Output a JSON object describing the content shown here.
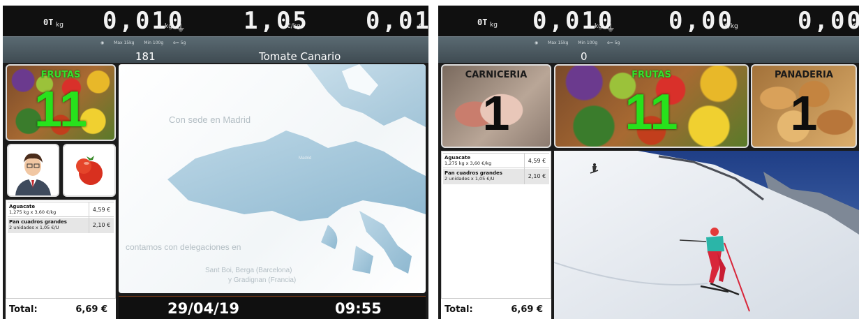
{
  "left": {
    "lcd": {
      "tare": "0T",
      "tare_unit": "kg",
      "weight": "0,010",
      "weight_unit": "kg",
      "price": "1,05",
      "price_unit": "€/kg",
      "total": "0,01",
      "total_unit": "€"
    },
    "info": {
      "max": "Max 15kg",
      "min": "Min 100g",
      "e": "e= 5g",
      "code": "181",
      "product": "Tomate Canario"
    },
    "category": {
      "name": "FRUTAS",
      "count": "11"
    },
    "ticket": {
      "lines": [
        {
          "name": "Aguacate",
          "detail": "1,275 kg x 3,60 €/kg",
          "amount": "4,59 €"
        },
        {
          "name": "Pan cuadros grandes",
          "detail": "2 unidades x 1,05 €/U",
          "amount": "2,10 €"
        }
      ],
      "total_label": "Total:",
      "total_value": "6,69 €"
    },
    "map": {
      "heading": "Con sede en Madrid",
      "small": "Madrid",
      "line1": "contamos con delegaciones en",
      "line2": "Sant Boi, Berga (Barcelona)",
      "line3": "y Gradignan (Francia)"
    },
    "date": "29/04/19",
    "time": "09:55"
  },
  "right": {
    "lcd": {
      "tare": "0T",
      "tare_unit": "kg",
      "weight": "0,010",
      "weight_unit": "kg",
      "price": "0,00",
      "price_unit": "€/kg",
      "total": "0,00",
      "total_unit": "€"
    },
    "info": {
      "max": "Max 15kg",
      "min": "Min 100g",
      "e": "e= 5g",
      "code": "0"
    },
    "categories": [
      {
        "name": "CARNICERIA",
        "count": "1"
      },
      {
        "name": "FRUTAS",
        "count": "11"
      },
      {
        "name": "PANADERIA",
        "count": "1"
      }
    ],
    "ticket": {
      "lines": [
        {
          "name": "Aguacate",
          "detail": "1,275 kg x 3,60 €/kg",
          "amount": "4,59 €"
        },
        {
          "name": "Pan cuadros grandes",
          "detail": "2 unidades x 1,05 €/U",
          "amount": "2,10 €"
        }
      ],
      "total_label": "Total:",
      "total_value": "6,69 €"
    }
  }
}
